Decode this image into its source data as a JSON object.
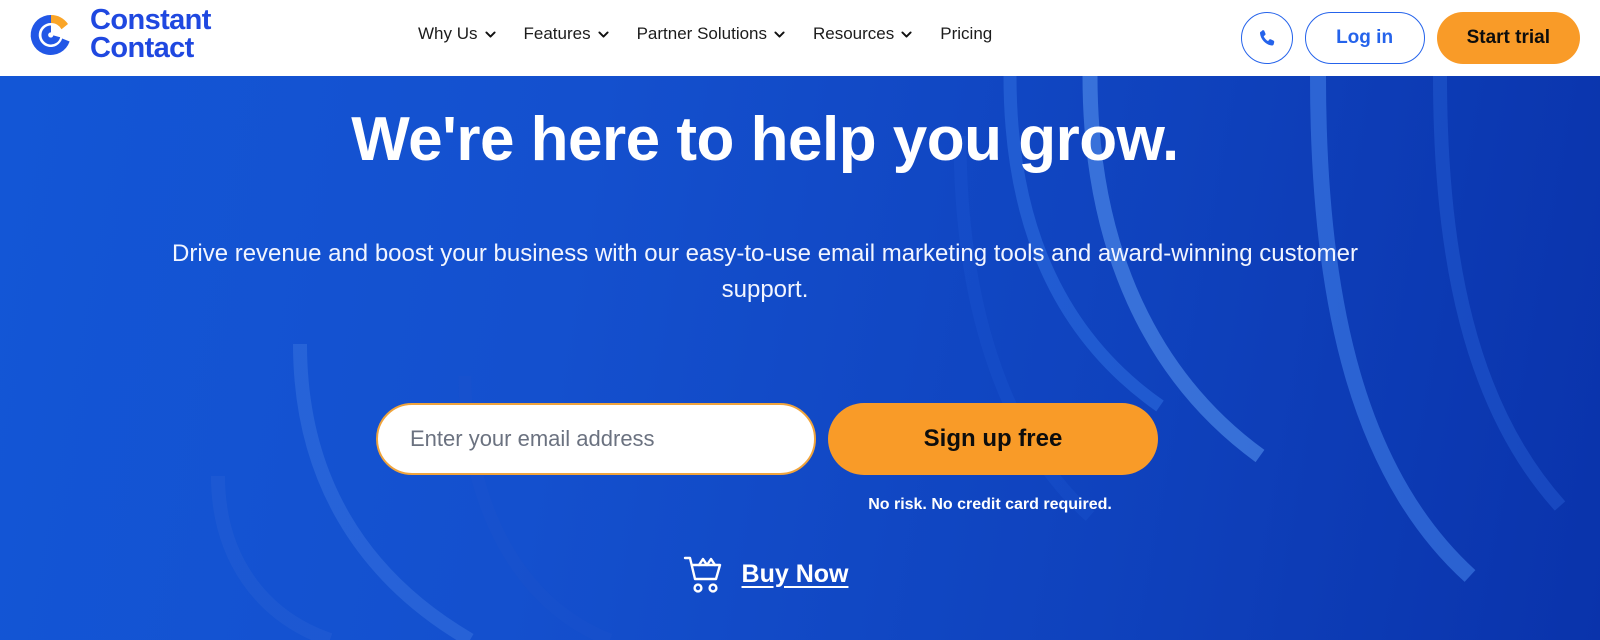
{
  "brand": {
    "logo_line1": "Constant",
    "logo_line2": "Contact",
    "logo_icon": "constant-contact-logo-icon",
    "blue": "#1f48e0",
    "orange": "#f99b28"
  },
  "header": {
    "nav": [
      {
        "label": "Why Us",
        "has_dropdown": true
      },
      {
        "label": "Features",
        "has_dropdown": true
      },
      {
        "label": "Partner Solutions",
        "has_dropdown": true
      },
      {
        "label": "Resources",
        "has_dropdown": true
      },
      {
        "label": "Pricing",
        "has_dropdown": false
      }
    ],
    "phone_icon": "phone-icon",
    "login_label": "Log in",
    "trial_label": "Start trial"
  },
  "hero": {
    "title": "We're here to help you grow.",
    "subtitle": "Drive revenue and boost your business with our easy-to-use email marketing tools and award-winning customer support.",
    "email_placeholder": "Enter your email address",
    "email_value": "",
    "signup_label": "Sign up free",
    "disclaimer": "No risk. No credit card required.",
    "buy_now_label": "Buy Now",
    "cart_icon": "shopping-cart-icon",
    "background_blue_left": "#1356d6",
    "background_blue_right": "#0a33ab"
  }
}
